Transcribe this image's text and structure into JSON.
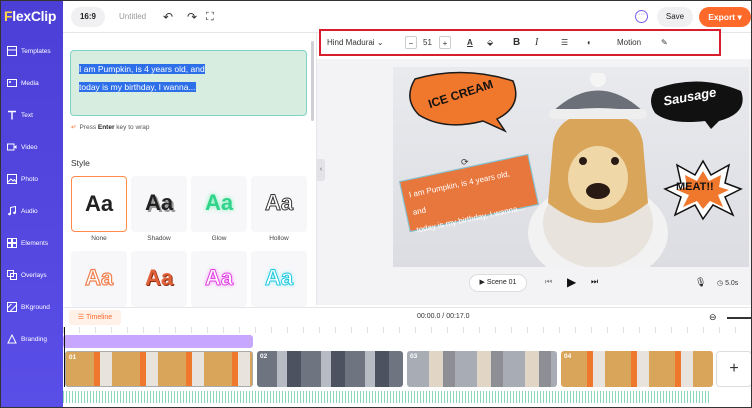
{
  "app": {
    "brand": "FlexClip",
    "brand_initial": "F",
    "brand_rest": "lexClip"
  },
  "topbar": {
    "ratio": "16:9",
    "project_title": "Untitled",
    "save_label": "Save",
    "export_label": "Export",
    "undo_icon": "undo-icon",
    "redo_icon": "redo-icon",
    "fullscreen_icon": "fullscreen-icon"
  },
  "sidebar": {
    "items": [
      {
        "label": "Templates",
        "icon": "templates-icon"
      },
      {
        "label": "Media",
        "icon": "media-icon"
      },
      {
        "label": "Text",
        "icon": "text-icon"
      },
      {
        "label": "Video",
        "icon": "video-icon"
      },
      {
        "label": "Photo",
        "icon": "photo-icon"
      },
      {
        "label": "Audio",
        "icon": "audio-icon"
      },
      {
        "label": "Elements",
        "icon": "elements-icon"
      },
      {
        "label": "Overlays",
        "icon": "overlays-icon"
      },
      {
        "label": "BKground",
        "icon": "background-icon"
      },
      {
        "label": "Branding",
        "icon": "branding-icon"
      }
    ]
  },
  "text_panel": {
    "text_line1": "I am Pumpkin, is  4  years old, and",
    "text_line2": "today is my birthday, I wanna...",
    "hint_prefix": "Press ",
    "hint_key": "Enter",
    "hint_suffix": " key to wrap",
    "style_title": "Style",
    "styles": [
      {
        "label": "None",
        "sample": "Aa"
      },
      {
        "label": "Shadow",
        "sample": "Aa"
      },
      {
        "label": "Glow",
        "sample": "Aa"
      },
      {
        "label": "Hollow",
        "sample": "Aa"
      },
      {
        "label": "",
        "sample": "Aa"
      },
      {
        "label": "",
        "sample": "Aa"
      },
      {
        "label": "",
        "sample": "Aa"
      },
      {
        "label": "",
        "sample": "Aa"
      }
    ]
  },
  "toolbar": {
    "font_name": "Hind Madurai",
    "font_size": "51",
    "minus": "−",
    "plus": "+",
    "motion_label": "Motion"
  },
  "canvas": {
    "bubble1": "ICE CREAM",
    "bubble2": "Sausage",
    "bubble3": "MEAT!!",
    "text_line1": "I am Pumpkin, is 4 years old, and",
    "text_line2": "today is my birthday, I wanna..."
  },
  "player": {
    "scene_label": "Scene 01",
    "duration": "5.0s"
  },
  "timeline": {
    "label": "Timeline",
    "time": "00:00.0 / 00:17.0",
    "clips": [
      {
        "num": "01"
      },
      {
        "num": "02"
      },
      {
        "num": "03"
      },
      {
        "num": "04"
      }
    ],
    "add_label": "+"
  }
}
